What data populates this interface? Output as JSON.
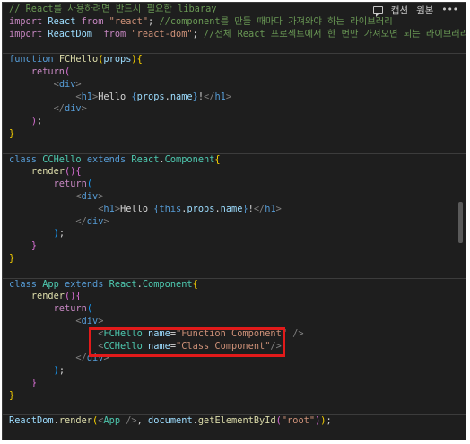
{
  "toolbar": {
    "caption_label": "캡션",
    "original_label": "원본",
    "more_label": "•••"
  },
  "code": {
    "l01_comment": "// React를 사용하려면 반드시 필요한 libaray",
    "l02_kw": "import",
    "l02_name": "React",
    "l02_from": "from",
    "l02_str": "\"react\"",
    "l02_semi": ";",
    "l02_comment": "//component를 만들 때마다 가져와야 하는 라이브러리",
    "l03_kw": "import",
    "l03_name": "ReactDom",
    "l03_from": "from",
    "l03_str": "\"react-dom\"",
    "l03_semi": ";",
    "l03_comment": "//전체 React 프로젝트에서 한 번만 가져오면 되는 라이브러리",
    "fn_kw": "function",
    "fn_name": "FCHello",
    "fn_param": "props",
    "return_kw": "return",
    "div_tag": "div",
    "h1_tag": "h1",
    "hello_text": "Hello ",
    "props_obj": "props",
    "name_prop": "name",
    "bang": "!",
    "class_kw": "class",
    "extends_kw": "extends",
    "cc_name": "CCHello",
    "react_obj": "React",
    "component_cls": "Component",
    "render_fn": "render",
    "this_kw": "this",
    "app_name": "App",
    "attr_name": "name",
    "fc_value": "\"Function Component\"",
    "cc_value": "\"Class Component\"",
    "reactdom_obj": "ReactDom",
    "render_call": "render",
    "document_obj": "document",
    "getby_fn": "getElementById",
    "root_str": "\"root\""
  }
}
